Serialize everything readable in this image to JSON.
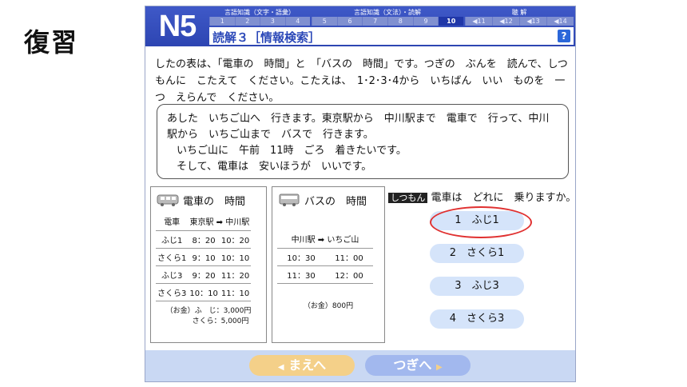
{
  "side_title": "復習",
  "header": {
    "logo": "N5",
    "sections": [
      {
        "title": "言語知識（文字・語彙）",
        "nums": [
          "1",
          "2",
          "3",
          "4"
        ]
      },
      {
        "title": "言語知識（文法）・読解",
        "nums": [
          "5",
          "6",
          "7",
          "8",
          "9",
          "10"
        ],
        "active": "10"
      },
      {
        "title": "聴 解",
        "nums": [
          "◀11",
          "◀12",
          "◀13",
          "◀14"
        ]
      }
    ],
    "subtitle": "読解３［情報検索］",
    "help": "?"
  },
  "instruction": "したの表は、「電車の　時間」と　「バスの　時間」です。つぎの　ぶんを　読んで、しつもんに　こたえて　ください。こたえは、　1･2･3･4から　いちばん　いい　ものを　一つ　えらんで　ください。",
  "passage": [
    "あした　いちご山へ　行きます。東京駅から　中川駅まで　電車で　行って、中川駅から　いちご山まで　バスで　行きます。",
    "いちご山に　午前　11時　ごろ　着きたいです。",
    "そして、電車は　安いほうが　いいです。"
  ],
  "train": {
    "title": "電車の　時間",
    "header": [
      "電車",
      "東京駅 ➡ 中川駅"
    ],
    "rows": [
      {
        "name": "ふじ1",
        "dep": "8：20",
        "arr": "10：20"
      },
      {
        "name": "さくら1",
        "dep": "9：10",
        "arr": "10：10"
      },
      {
        "name": "ふじ3",
        "dep": "9：20",
        "arr": "11：20"
      },
      {
        "name": "さくら3",
        "dep": "10：10",
        "arr": "11：10"
      }
    ],
    "fare1": "（お金）ふ　じ：3,000円",
    "fare2": "さくら：5,000円"
  },
  "bus": {
    "title": "バスの　時間",
    "header": "中川駅 ➡ いちご山",
    "rows": [
      {
        "dep": "10：30",
        "arr": "11：00"
      },
      {
        "dep": "11：30",
        "arr": "12：00"
      }
    ],
    "fare": "（お金）800円"
  },
  "question": {
    "tag": "しつもん",
    "text": "電車は　どれに　乗りますか。"
  },
  "options": [
    "1　ふじ1",
    "2　さくら1",
    "3　ふじ3",
    "4　さくら3"
  ],
  "nav": {
    "prev": "まえへ",
    "next": "つぎへ"
  }
}
